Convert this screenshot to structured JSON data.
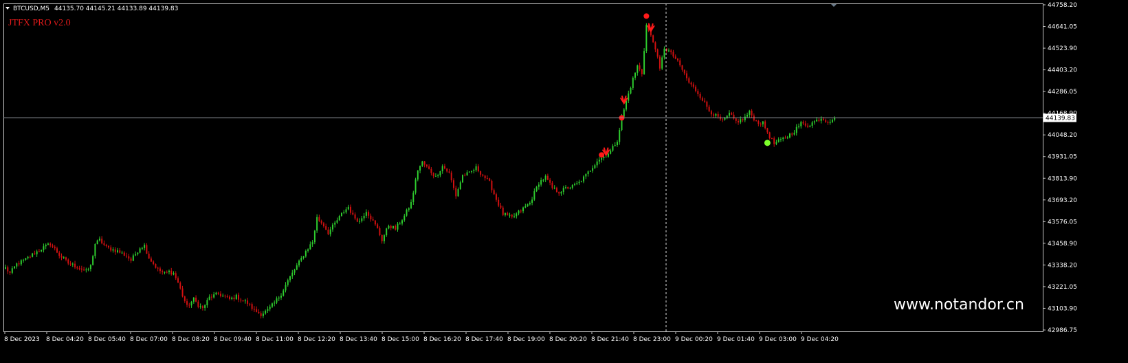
{
  "header": {
    "symbol": "BTCUSD,M5",
    "ohlc": "44135.70 44145.21 44133.89 44139.83",
    "indicator": "JTFX PRO v2.0"
  },
  "watermark": "www.notandor.cn",
  "colors": {
    "background": "#000000",
    "axis": "#ffffff",
    "bull": "#2ecc2e",
    "bear": "#d01010",
    "signal_sell": "#ff1a1a",
    "signal_buy": "#7dff2a",
    "bid_line": "#9aa0a6"
  },
  "current_price": "44139.83",
  "chart_data": {
    "type": "candlestick",
    "y_ticks": [
      "44758.20",
      "44641.05",
      "44523.90",
      "44403.20",
      "44286.05",
      "44168.90",
      "44048.20",
      "43931.05",
      "43813.90",
      "43693.20",
      "43576.05",
      "43458.90",
      "43338.20",
      "43221.05",
      "43103.90",
      "42986.75"
    ],
    "ylim": [
      42986.75,
      44758.2
    ],
    "x_ticks": [
      "8 Dec 2023",
      "8 Dec 04:20",
      "8 Dec 05:40",
      "8 Dec 07:00",
      "8 Dec 08:20",
      "8 Dec 09:40",
      "8 Dec 11:00",
      "8 Dec 12:20",
      "8 Dec 13:40",
      "8 Dec 15:00",
      "8 Dec 16:20",
      "8 Dec 17:40",
      "8 Dec 19:00",
      "8 Dec 20:20",
      "8 Dec 21:40",
      "8 Dec 23:00",
      "9 Dec 00:20",
      "9 Dec 01:40",
      "9 Dec 03:00",
      "9 Dec 04:20"
    ],
    "bid": 44139.83,
    "crosshair_x_label": "8 Dec 23:00",
    "anchors": [
      [
        0,
        43330
      ],
      [
        2,
        43300
      ],
      [
        5,
        43350
      ],
      [
        9,
        43375
      ],
      [
        13,
        43410
      ],
      [
        17,
        43440
      ],
      [
        20,
        43460
      ],
      [
        24,
        43400
      ],
      [
        28,
        43355
      ],
      [
        33,
        43330
      ],
      [
        36,
        43310
      ],
      [
        38,
        43340
      ],
      [
        40,
        43460
      ],
      [
        42,
        43480
      ],
      [
        45,
        43440
      ],
      [
        50,
        43420
      ],
      [
        54,
        43395
      ],
      [
        56,
        43370
      ],
      [
        60,
        43440
      ],
      [
        62,
        43450
      ],
      [
        64,
        43385
      ],
      [
        68,
        43320
      ],
      [
        71,
        43300
      ],
      [
        73,
        43310
      ],
      [
        75,
        43300
      ],
      [
        77,
        43250
      ],
      [
        79,
        43180
      ],
      [
        81,
        43120
      ],
      [
        84,
        43160
      ],
      [
        86,
        43130
      ],
      [
        88,
        43110
      ],
      [
        91,
        43170
      ],
      [
        95,
        43190
      ],
      [
        100,
        43160
      ],
      [
        103,
        43175
      ],
      [
        105,
        43160
      ],
      [
        108,
        43140
      ],
      [
        111,
        43100
      ],
      [
        114,
        43080
      ],
      [
        117,
        43100
      ],
      [
        120,
        43140
      ],
      [
        123,
        43190
      ],
      [
        126,
        43260
      ],
      [
        130,
        43340
      ],
      [
        134,
        43420
      ],
      [
        137,
        43470
      ],
      [
        139,
        43600
      ],
      [
        142,
        43560
      ],
      [
        144,
        43520
      ],
      [
        147,
        43570
      ],
      [
        150,
        43620
      ],
      [
        153,
        43660
      ],
      [
        155,
        43610
      ],
      [
        158,
        43580
      ],
      [
        161,
        43640
      ],
      [
        163,
        43600
      ],
      [
        166,
        43540
      ],
      [
        168,
        43480
      ],
      [
        171,
        43560
      ],
      [
        174,
        43540
      ],
      [
        178,
        43610
      ],
      [
        181,
        43680
      ],
      [
        184,
        43860
      ],
      [
        186,
        43900
      ],
      [
        189,
        43860
      ],
      [
        192,
        43820
      ],
      [
        195,
        43880
      ],
      [
        198,
        43840
      ],
      [
        201,
        43720
      ],
      [
        204,
        43830
      ],
      [
        207,
        43840
      ],
      [
        210,
        43870
      ],
      [
        213,
        43830
      ],
      [
        216,
        43790
      ],
      [
        219,
        43700
      ],
      [
        222,
        43620
      ],
      [
        226,
        43600
      ],
      [
        230,
        43640
      ],
      [
        234,
        43680
      ],
      [
        238,
        43790
      ],
      [
        241,
        43820
      ],
      [
        244,
        43760
      ],
      [
        247,
        43740
      ],
      [
        250,
        43760
      ],
      [
        253,
        43770
      ],
      [
        256,
        43790
      ],
      [
        259,
        43830
      ],
      [
        261,
        43860
      ],
      [
        264,
        43910
      ],
      [
        267,
        43930
      ],
      [
        270,
        43960
      ],
      [
        273,
        44020
      ],
      [
        275,
        44140
      ],
      [
        277,
        44230
      ],
      [
        280,
        44350
      ],
      [
        282,
        44420
      ],
      [
        284,
        44380
      ],
      [
        286,
        44640
      ],
      [
        288,
        44580
      ],
      [
        290,
        44520
      ],
      [
        292,
        44400
      ],
      [
        294,
        44520
      ],
      [
        296,
        44500
      ],
      [
        299,
        44460
      ],
      [
        302,
        44400
      ],
      [
        305,
        44330
      ],
      [
        308,
        44290
      ],
      [
        311,
        44240
      ],
      [
        314,
        44180
      ],
      [
        317,
        44150
      ],
      [
        320,
        44120
      ],
      [
        323,
        44160
      ],
      [
        326,
        44120
      ],
      [
        329,
        44130
      ],
      [
        332,
        44170
      ],
      [
        335,
        44120
      ],
      [
        338,
        44110
      ],
      [
        341,
        44040
      ],
      [
        343,
        44000
      ],
      [
        346,
        44020
      ],
      [
        349,
        44040
      ],
      [
        352,
        44070
      ],
      [
        355,
        44110
      ],
      [
        358,
        44100
      ],
      [
        361,
        44120
      ],
      [
        364,
        44140
      ],
      [
        367,
        44120
      ],
      [
        370,
        44140
      ]
    ],
    "signals": [
      {
        "type": "sell-arrow",
        "bar": 268,
        "price": 43950
      },
      {
        "type": "sell-dot",
        "bar": 266,
        "price": 43940
      },
      {
        "type": "sell-dot",
        "bar": 275,
        "price": 44140
      },
      {
        "type": "sell-arrow",
        "bar": 276,
        "price": 44230
      },
      {
        "type": "sell-dot",
        "bar": 286,
        "price": 44690
      },
      {
        "type": "sell-arrow",
        "bar": 288,
        "price": 44620
      },
      {
        "type": "buy-dot",
        "bar": 340,
        "price": 44005
      }
    ]
  }
}
